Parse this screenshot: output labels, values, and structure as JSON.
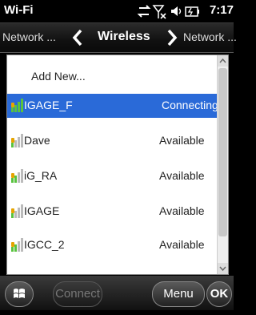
{
  "status_bar": {
    "title": "Wi-Fi",
    "time": "7:17"
  },
  "nav": {
    "prev_label": "Network ...",
    "title": "Wireless",
    "next_label": "Network ..."
  },
  "list": {
    "add_label": "Add New...",
    "networks": [
      {
        "name": "IGAGE_F",
        "status": "Connecting",
        "selected": true
      },
      {
        "name": "Dave",
        "status": "Available"
      },
      {
        "name": "iG_RA",
        "status": "Available"
      },
      {
        "name": "IGAGE",
        "status": "Available"
      },
      {
        "name": "IGCC_2",
        "status": "Available"
      }
    ]
  },
  "softkeys": {
    "connect_label": "Connect",
    "menu_label": "Menu",
    "ok_label": "OK"
  },
  "colors": {
    "selected_row": "#2a6ad8",
    "signal_lock": "#e6a400",
    "signal_bar": "#59c23f"
  }
}
